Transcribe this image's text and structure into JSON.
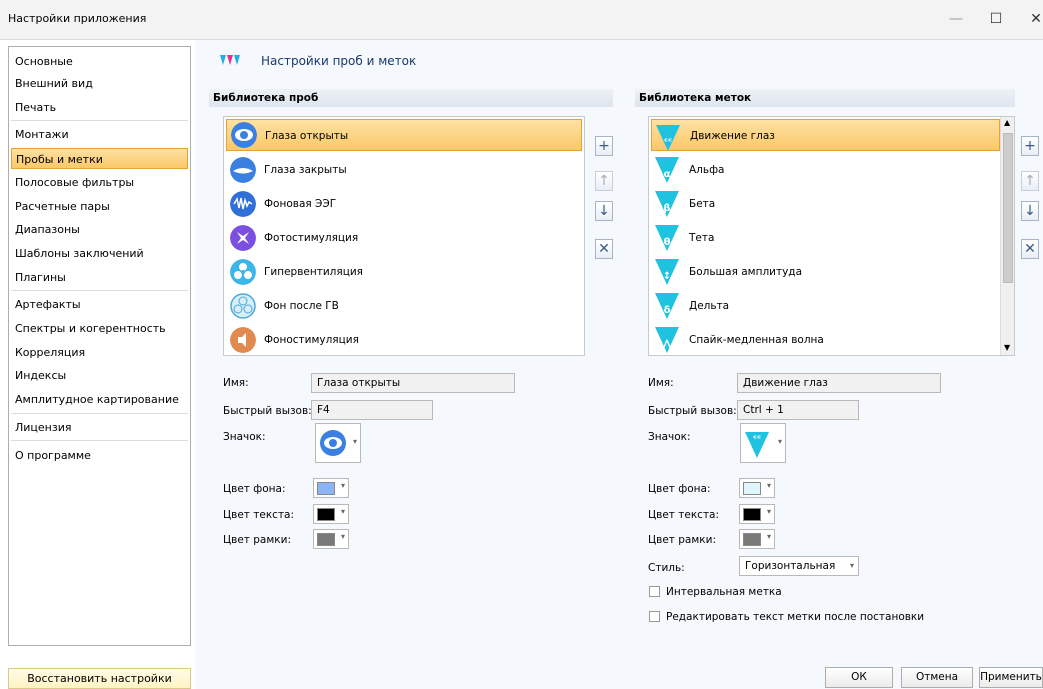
{
  "window": {
    "title": "Настройки приложения",
    "minimize_icon": "—",
    "maximize_icon": "☐",
    "close_icon": "✕"
  },
  "sidebar": {
    "items": [
      {
        "label": "Основные"
      },
      {
        "label": "Внешний вид"
      },
      {
        "label": "Печать"
      },
      {
        "label": "Монтажи"
      },
      {
        "label": "Пробы и метки",
        "active": true
      },
      {
        "label": "Полосовые фильтры"
      },
      {
        "label": "Расчетные пары"
      },
      {
        "label": "Диапазоны"
      },
      {
        "label": "Шаблоны заключений"
      },
      {
        "label": "Плагины"
      },
      {
        "label": "Артефакты"
      },
      {
        "label": "Спектры и когерентность"
      },
      {
        "label": "Корреляция"
      },
      {
        "label": "Индексы"
      },
      {
        "label": "Амплитудное картирование"
      },
      {
        "label": "Лицензия"
      },
      {
        "label": "О программе"
      }
    ],
    "restore_label": "Восстановить настройки"
  },
  "page": {
    "title": "Настройки проб и меток"
  },
  "probes": {
    "header": "Библиотека проб",
    "items": [
      {
        "label": "Глаза открыты",
        "icon": "eye-open-icon",
        "color": "#3b7fe0",
        "selected": true
      },
      {
        "label": "Глаза закрыты",
        "icon": "eye-closed-icon",
        "color": "#3b7fe0"
      },
      {
        "label": "Фоновая ЭЭГ",
        "icon": "eeg-wave-icon",
        "color": "#2f6fd8"
      },
      {
        "label": "Фотостимуляция",
        "icon": "photostim-icon",
        "color": "#7b4fe0"
      },
      {
        "label": "Гипервентиляция",
        "icon": "fan-icon",
        "color": "#3ab6e8"
      },
      {
        "label": "Фон после ГВ",
        "icon": "fan-after-icon",
        "color": "#4aa9d8"
      },
      {
        "label": "Фоностимуляция",
        "icon": "speaker-icon",
        "color": "#e08a50"
      }
    ],
    "name_label": "Имя:",
    "name_value": "Глаза открыты",
    "hotkey_label": "Быстрый вызов:",
    "hotkey_value": "F4",
    "icon_label": "Значок:",
    "bg_label": "Цвет фона:",
    "bg_color": "#8ab4f5",
    "text_label": "Цвет текста:",
    "text_color": "#000000",
    "border_label": "Цвет рамки:",
    "border_color": "#7a7a7a"
  },
  "marks": {
    "header": "Библиотека меток",
    "items": [
      {
        "label": "Движение глаз",
        "glyph": "ᶜᶜ",
        "selected": true
      },
      {
        "label": "Альфа",
        "glyph": "α"
      },
      {
        "label": "Бета",
        "glyph": "β"
      },
      {
        "label": "Тета",
        "glyph": "θ"
      },
      {
        "label": "Большая амплитуда",
        "glyph": "↕"
      },
      {
        "label": "Дельта",
        "glyph": "δ"
      },
      {
        "label": "Спайк-медленная волна",
        "glyph": "⋀"
      }
    ],
    "name_label": "Имя:",
    "name_value": "Движение глаз",
    "hotkey_label": "Быстрый вызов:",
    "hotkey_value": "Ctrl + 1",
    "icon_label": "Значок:",
    "bg_label": "Цвет фона:",
    "bg_color": "#dff6fb",
    "text_label": "Цвет текста:",
    "text_color": "#000000",
    "border_label": "Цвет рамки:",
    "border_color": "#7a7a7a",
    "style_label": "Стиль:",
    "style_value": "Горизонтальная",
    "interval_label": "Интервальная метка",
    "edit_label": "Редактировать текст метки после постановки"
  },
  "side_buttons": {
    "add": "+",
    "up": "↑",
    "down": "↓",
    "delete": "✕"
  },
  "footer": {
    "ok": "ОК",
    "cancel": "Отмена",
    "apply": "Применить"
  },
  "colors": {
    "accent_selection": "#fbc866",
    "mark_triangle": "#1fc3e0"
  }
}
